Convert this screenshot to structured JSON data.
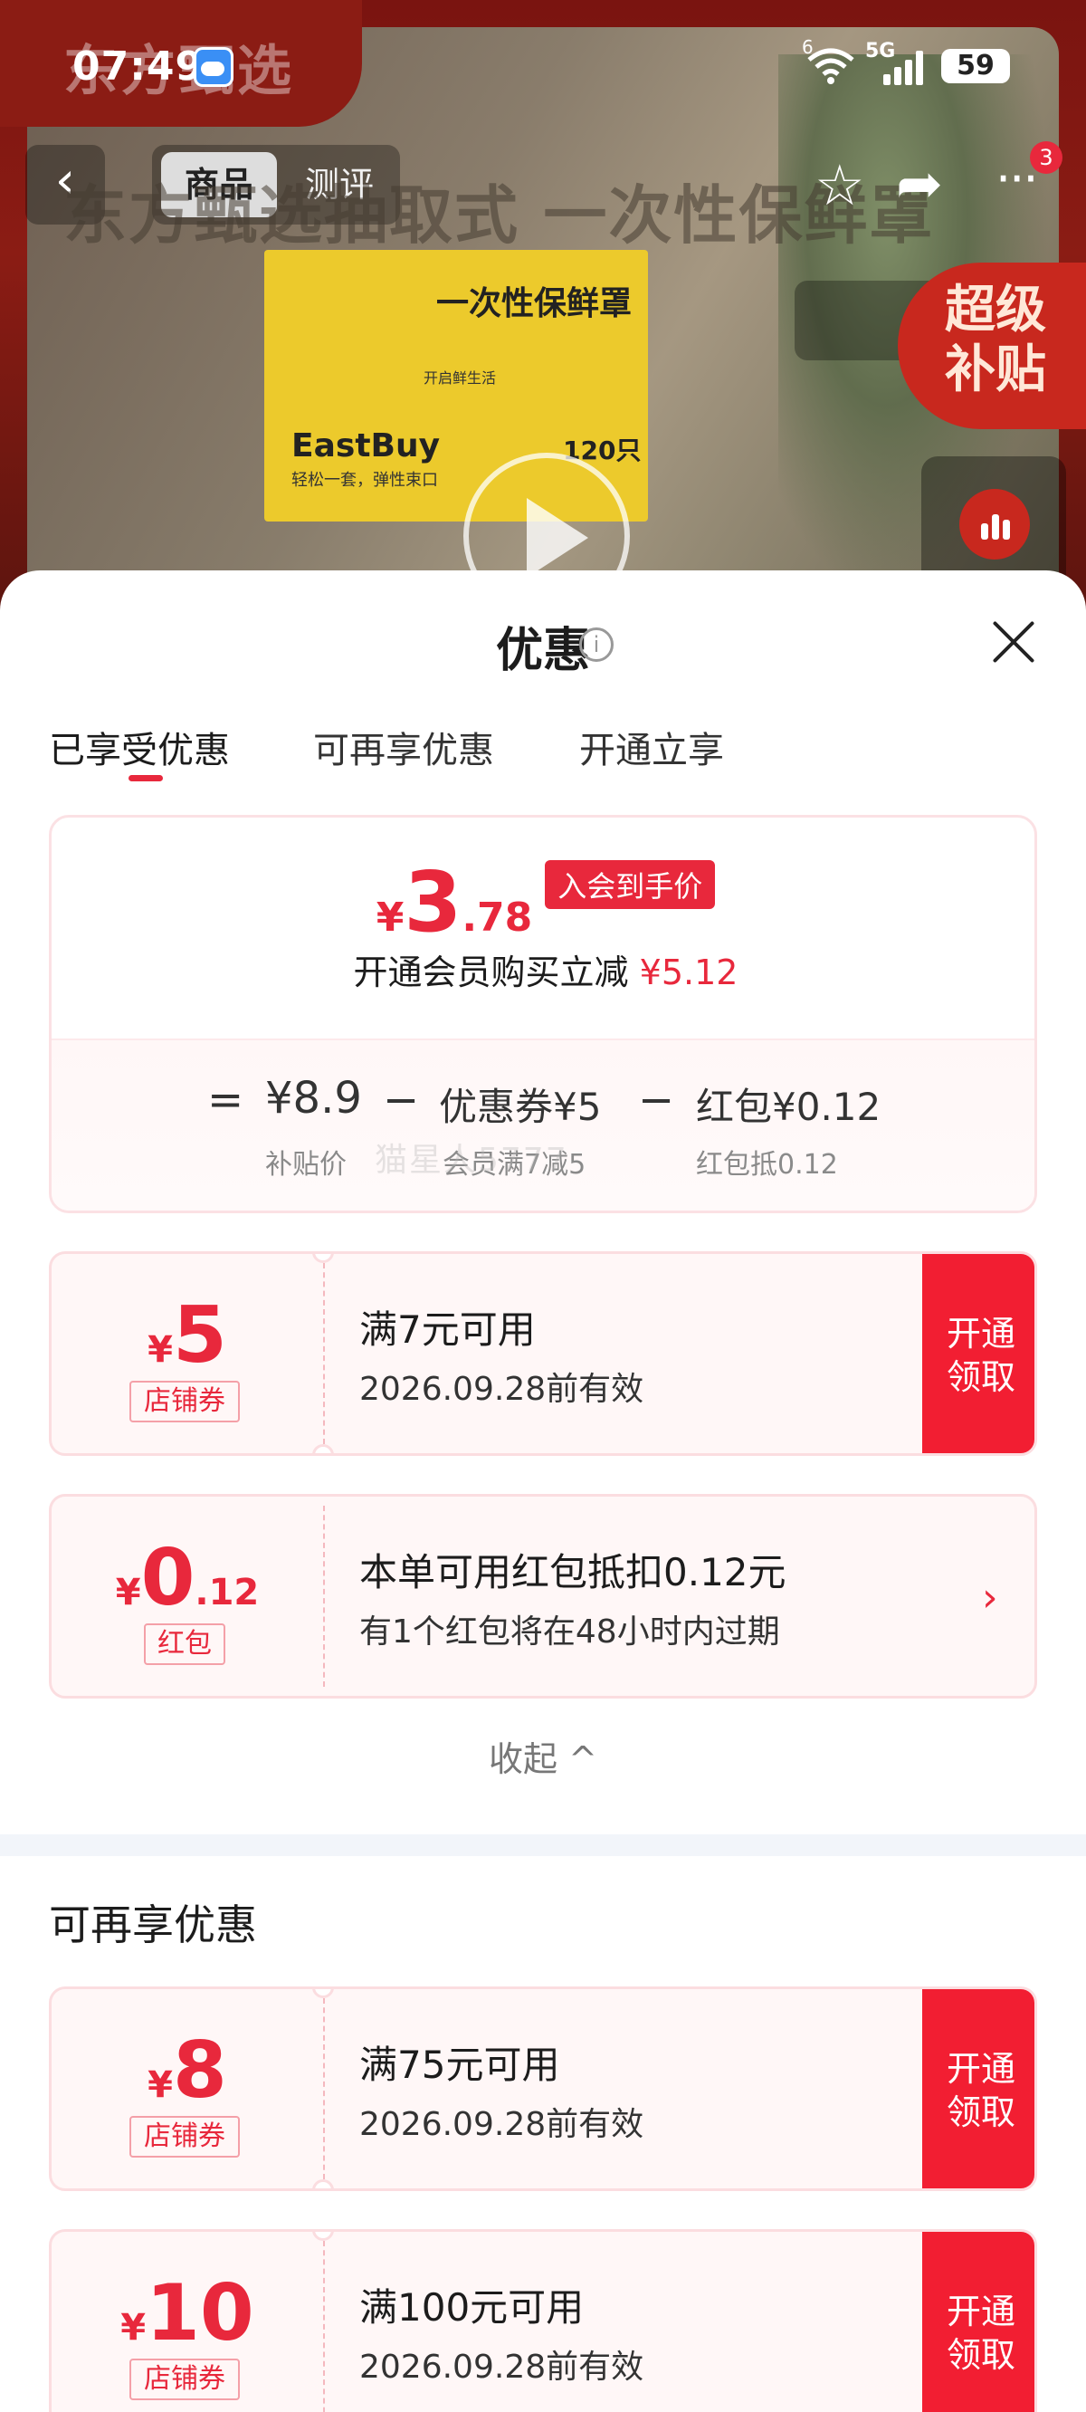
{
  "status": {
    "time": "07:49",
    "network": "5G",
    "wifi_sup": "6",
    "battery": "59"
  },
  "header": {
    "brand": "东方甄选",
    "tabs": [
      "商品",
      "测评"
    ],
    "headline": "东方甄选抽取式 一次性保鲜罩",
    "badge_count": "3",
    "super_subsidy": [
      "超级",
      "补贴"
    ]
  },
  "product_box": {
    "title": "一次性保鲜罩",
    "slogan": "开启鲜生活",
    "brand": "EastBuy",
    "sub": "轻松一套，弹性束口",
    "count": "120只"
  },
  "sheet": {
    "title": "优惠",
    "tabs": [
      "已享受优惠",
      "可再享优惠",
      "开通立享"
    ],
    "summary": {
      "currency": "¥",
      "price_int": "3",
      "price_dec": ".78",
      "price_tag": "入会到手价",
      "reduce_text": "开通会员购买立减",
      "reduce_amount": "¥5.12",
      "breakdown": [
        {
          "value": "¥8.9",
          "label": "补贴价"
        },
        {
          "value": "优惠券¥5",
          "label": "会员满7减5"
        },
        {
          "value": "红包¥0.12",
          "label": "红包抵0.12"
        }
      ],
      "eq": "=",
      "minus": "−"
    },
    "watermark": "猫星人5777",
    "enjoyed_coupons": [
      {
        "currency": "¥",
        "int": "5",
        "dec": "",
        "tag": "店铺券",
        "line1": "满7元可用",
        "line2": "2026.09.28前有效",
        "btn": [
          "开通",
          "领取"
        ]
      },
      {
        "currency": "¥",
        "int": "0",
        "dec": ".12",
        "tag": "红包",
        "line1": "本单可用红包抵扣0.12元",
        "line2": "有1个红包将在48小时内过期",
        "chevron": "›"
      }
    ],
    "collapse": "收起 ^",
    "more_title": "可再享优惠",
    "more_coupons": [
      {
        "currency": "¥",
        "int": "8",
        "dec": "",
        "tag": "店铺券",
        "line1": "满75元可用",
        "line2": "2026.09.28前有效",
        "btn": [
          "开通",
          "领取"
        ]
      },
      {
        "currency": "¥",
        "int": "10",
        "dec": "",
        "tag": "店铺券",
        "line1": "满100元可用",
        "line2": "2026.09.28前有效",
        "btn": [
          "开通",
          "领取"
        ]
      }
    ]
  },
  "colors": {
    "accent": "#e8283c",
    "button": "#f21e32",
    "coupon_bg": "#fff7f7"
  }
}
